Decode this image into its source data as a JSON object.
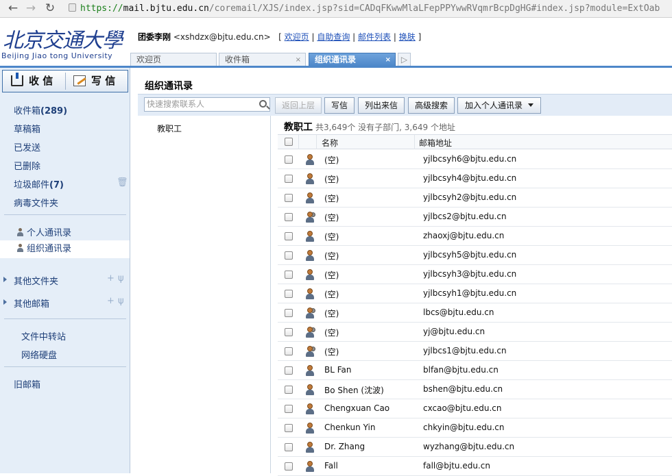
{
  "browser": {
    "url_scheme": "https://",
    "url_host": "mail.bjtu.edu.cn",
    "url_path": "/coremail/XJS/index.jsp?sid=CADqFKwwMlaLFepPPYwwRVqmrBcpDgHG#index.jsp?module=ExtOab"
  },
  "logo": {
    "cn": "北京交通大學",
    "en": "Beijing Jiao tong University"
  },
  "user": {
    "name": "团委李刚",
    "email": "<xshdzx@bjtu.edu.cn>",
    "links": [
      "欢迎页",
      "自助查询",
      "邮件列表",
      "换肤"
    ],
    "bracket_open": "[",
    "bracket_close": "]",
    "sep": "|"
  },
  "tabs": [
    {
      "label": "欢迎页"
    },
    {
      "label": "收件箱",
      "close": "×"
    },
    {
      "label": "组织通讯录",
      "close": "×"
    }
  ],
  "sidebar": {
    "receive": "收 信",
    "compose": "写 信",
    "folders": [
      {
        "label": "收件箱",
        "count": "(289)"
      },
      {
        "label": "草稿箱"
      },
      {
        "label": "已发送"
      },
      {
        "label": "已删除"
      },
      {
        "label": "垃圾邮件",
        "count": "(7)"
      },
      {
        "label": "病毒文件夹"
      }
    ],
    "contacts": [
      "个人通讯录",
      "组织通讯录"
    ],
    "other_folders": "其他文件夹",
    "other_mailboxes": "其他邮箱",
    "tools": [
      "文件中转站",
      "网络硬盘"
    ],
    "old_mailbox": "旧邮箱"
  },
  "main": {
    "title": "组织通讯录",
    "search_placeholder": "快速搜索联系人",
    "buttons": [
      "返回上层",
      "写信",
      "列出来信",
      "高级搜索",
      "加入个人通讯录"
    ],
    "group_item": "教职工",
    "group_name": "教职工",
    "group_summary": "共3,649个 没有子部门, 3,649 个地址",
    "col_name": "名称",
    "col_email": "邮箱地址"
  },
  "contacts": [
    {
      "name": "(空)",
      "email": "yjlbcsyh6@bjtu.edu.cn",
      "multi": false
    },
    {
      "name": "(空)",
      "email": "yjlbcsyh4@bjtu.edu.cn",
      "multi": false
    },
    {
      "name": "(空)",
      "email": "yjlbcsyh2@bjtu.edu.cn",
      "multi": false
    },
    {
      "name": "(空)",
      "email": "yjlbcs2@bjtu.edu.cn",
      "multi": true
    },
    {
      "name": "(空)",
      "email": "zhaoxj@bjtu.edu.cn",
      "multi": false
    },
    {
      "name": "(空)",
      "email": "yjlbcsyh5@bjtu.edu.cn",
      "multi": false
    },
    {
      "name": "(空)",
      "email": "yjlbcsyh3@bjtu.edu.cn",
      "multi": false
    },
    {
      "name": "(空)",
      "email": "yjlbcsyh1@bjtu.edu.cn",
      "multi": false
    },
    {
      "name": "(空)",
      "email": "lbcs@bjtu.edu.cn",
      "multi": true
    },
    {
      "name": "(空)",
      "email": "yj@bjtu.edu.cn",
      "multi": true
    },
    {
      "name": "(空)",
      "email": "yjlbcs1@bjtu.edu.cn",
      "multi": true
    },
    {
      "name": "BL Fan",
      "email": "blfan@bjtu.edu.cn",
      "multi": false
    },
    {
      "name": "Bo Shen (沈波)",
      "email": "bshen@bjtu.edu.cn",
      "multi": false
    },
    {
      "name": "Chengxuan Cao",
      "email": "cxcao@bjtu.edu.cn",
      "multi": false
    },
    {
      "name": "Chenkun Yin",
      "email": "chkyin@bjtu.edu.cn",
      "multi": false
    },
    {
      "name": "Dr. Zhang",
      "email": "wyzhang@bjtu.edu.cn",
      "multi": false
    },
    {
      "name": "Fall",
      "email": "fall@bjtu.edu.cn",
      "multi": false
    }
  ]
}
